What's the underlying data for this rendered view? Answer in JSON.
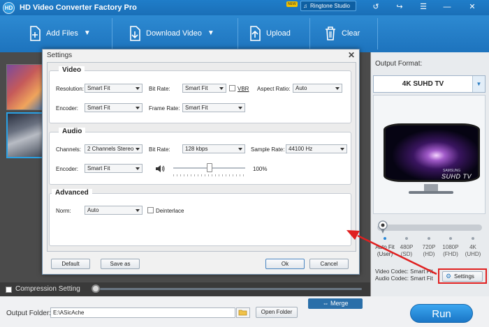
{
  "app": {
    "title": "HD Video Converter Factory Pro",
    "logo": "HD",
    "new_badge": "NEW",
    "ringtone_label": "Ringtone Studio"
  },
  "window_controls": {
    "back": "↺",
    "share": "↪",
    "menu": "☰",
    "minimize": "—",
    "close": "✕"
  },
  "toolbar": {
    "add_files": "Add Files",
    "download_video": "Download Video",
    "upload": "Upload",
    "clear": "Clear"
  },
  "dialog": {
    "title": "Settings",
    "close": "✕",
    "video": {
      "heading": "Video",
      "resolution_label": "Resolution:",
      "resolution_value": "Smart Fit",
      "bitrate_label": "Bit Rate:",
      "bitrate_value": "Smart Fit",
      "vbr_label": "VBR",
      "aspect_label": "Aspect Ratio:",
      "aspect_value": "Auto",
      "encoder_label": "Encoder:",
      "encoder_value": "Smart Fit",
      "framerate_label": "Frame Rate:",
      "framerate_value": "Smart Fit"
    },
    "audio": {
      "heading": "Audio",
      "channels_label": "Channels:",
      "channels_value": "2 Channels Stereo",
      "bitrate_label": "Bit Rate:",
      "bitrate_value": "128 kbps",
      "samplerate_label": "Sample Rate:",
      "samplerate_value": "44100 Hz",
      "encoder_label": "Encoder:",
      "encoder_value": "Smart Fit",
      "volume_value": "100%",
      "volume_fraction": 0.5
    },
    "advanced": {
      "heading": "Advanced",
      "norm_label": "Norm:",
      "norm_value": "Auto",
      "deinterlace_label": "Deinterlace"
    },
    "buttons": {
      "default": "Default",
      "save_as": "Save as",
      "ok": "Ok",
      "cancel": "Cancel"
    }
  },
  "right_panel": {
    "output_format_label": "Output Format:",
    "format_value": "4K SUHD TV",
    "tv_brand": "SAMSUNG",
    "tv_suhd": "SUHD TV",
    "quality_options": [
      {
        "name": "Auto Fit",
        "sub": "(User)"
      },
      {
        "name": "480P",
        "sub": "(SD)"
      },
      {
        "name": "720P",
        "sub": "(HD)"
      },
      {
        "name": "1080P",
        "sub": "(FHD)"
      },
      {
        "name": "4K",
        "sub": "(UHD)"
      }
    ],
    "video_codec": "Video Codec: Smart Fit",
    "audio_codec": "Audio Codec: Smart Fit",
    "settings_label": "Settings"
  },
  "compression": {
    "label": "Compression Setting"
  },
  "bottom": {
    "merge_label": "Merge",
    "output_folder_label": "Output Folder:",
    "output_folder_value": "E:\\ASicAche",
    "open_folder_label": "Open Folder",
    "run_label": "Run"
  },
  "colors": {
    "title_blue": "#1f7dc9",
    "toolbar_blue": "#2d8ad2",
    "highlight_red": "#e02020",
    "run_blue": "#2a8ee0"
  }
}
